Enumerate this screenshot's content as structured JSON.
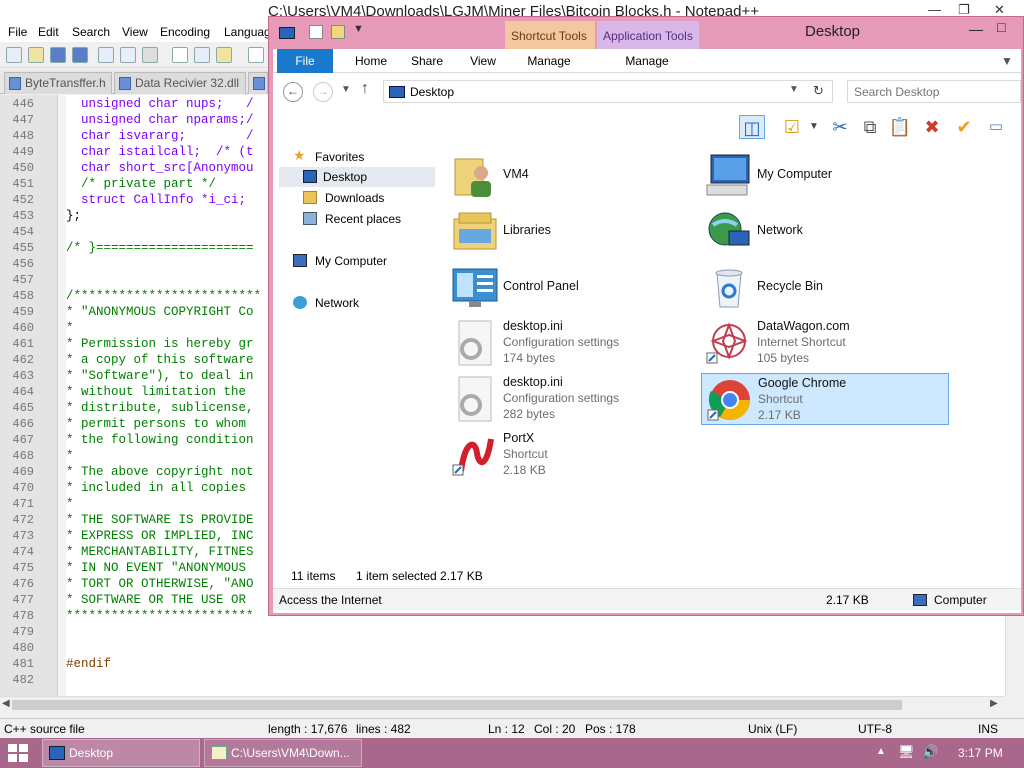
{
  "notepad": {
    "title": "C:\\Users\\VM4\\Downloads\\LGJM\\Miner Files\\Bitcoin Blocks.h - Notepad++",
    "menu": [
      "File",
      "Edit",
      "Search",
      "View",
      "Encoding",
      "Languag"
    ],
    "tabs": [
      "ByteTransffer.h",
      "Data Recivier 32.dll"
    ],
    "lines": [
      {
        "n": "446",
        "code": "  unsigned char nups;   /"
      },
      {
        "n": "447",
        "code": "  unsigned char nparams;/"
      },
      {
        "n": "448",
        "code": "  char isvararg;        /"
      },
      {
        "n": "449",
        "code": "  char istailcall;  /* (t"
      },
      {
        "n": "450",
        "code": "  char short_src[Anonymou"
      },
      {
        "n": "451",
        "code": "  /* private part */"
      },
      {
        "n": "452",
        "code": "  struct CallInfo *i_ci;"
      },
      {
        "n": "453",
        "code": "};"
      },
      {
        "n": "454",
        "code": ""
      },
      {
        "n": "455",
        "code": "/* }====================="
      },
      {
        "n": "456",
        "code": ""
      },
      {
        "n": "457",
        "code": ""
      },
      {
        "n": "458",
        "code": "/*************************"
      },
      {
        "n": "459",
        "code": "* \"ANONYMOUS COPYRIGHT Co"
      },
      {
        "n": "460",
        "code": "*"
      },
      {
        "n": "461",
        "code": "* Permission is hereby gr"
      },
      {
        "n": "462",
        "code": "* a copy of this software"
      },
      {
        "n": "463",
        "code": "* \"Software\"), to deal in"
      },
      {
        "n": "464",
        "code": "* without limitation the"
      },
      {
        "n": "465",
        "code": "* distribute, sublicense,"
      },
      {
        "n": "466",
        "code": "* permit persons to whom"
      },
      {
        "n": "467",
        "code": "* the following condition"
      },
      {
        "n": "468",
        "code": "*"
      },
      {
        "n": "469",
        "code": "* The above copyright not"
      },
      {
        "n": "470",
        "code": "* included in all copies"
      },
      {
        "n": "471",
        "code": "*"
      },
      {
        "n": "472",
        "code": "* THE SOFTWARE IS PROVIDE"
      },
      {
        "n": "473",
        "code": "* EXPRESS OR IMPLIED, INC"
      },
      {
        "n": "474",
        "code": "* MERCHANTABILITY, FITNES"
      },
      {
        "n": "475",
        "code": "* IN NO EVENT \"ANONYMOUS"
      },
      {
        "n": "476",
        "code": "* TORT OR OTHERWISE, \"ANO"
      },
      {
        "n": "477",
        "code": "* SOFTWARE OR THE USE OR"
      },
      {
        "n": "478",
        "code": "*************************"
      },
      {
        "n": "479",
        "code": ""
      },
      {
        "n": "480",
        "code": ""
      },
      {
        "n": "481",
        "code": "#endif"
      },
      {
        "n": "482",
        "code": ""
      }
    ],
    "status": {
      "filetype": "C++ source file",
      "length": "length : 17,676",
      "lines": "lines : 482",
      "ln": "Ln : 12",
      "col": "Col : 20",
      "pos": "Pos : 178",
      "eol": "Unix (LF)",
      "encoding": "UTF-8",
      "mode": "INS"
    }
  },
  "explorer": {
    "title": "Desktop",
    "context_tabs": [
      "Shortcut Tools",
      "Application Tools"
    ],
    "ribbon_tabs": [
      "File",
      "Home",
      "Share",
      "View",
      "Manage",
      "Manage"
    ],
    "address": "Desktop",
    "search_placeholder": "Search Desktop",
    "nav": {
      "favorites": "Favorites",
      "desktop": "Desktop",
      "downloads": "Downloads",
      "recent": "Recent places",
      "computer": "My Computer",
      "network": "Network"
    },
    "files_left": [
      {
        "name": "VM4",
        "icon": "user-folder-icon"
      },
      {
        "name": "Libraries",
        "icon": "libraries-icon"
      },
      {
        "name": "Control Panel",
        "icon": "control-panel-icon"
      },
      {
        "name": "desktop.ini",
        "type": "Configuration settings",
        "size": "174 bytes",
        "icon": "settings-file-icon"
      },
      {
        "name": "desktop.ini",
        "type": "Configuration settings",
        "size": "282 bytes",
        "icon": "settings-file-icon"
      },
      {
        "name": "PortX",
        "type": "Shortcut",
        "size": "2.18 KB",
        "icon": "portx-icon"
      }
    ],
    "files_right": [
      {
        "name": "My Computer",
        "icon": "computer-icon"
      },
      {
        "name": "Network",
        "icon": "network-icon"
      },
      {
        "name": "Recycle Bin",
        "icon": "recycle-bin-icon"
      },
      {
        "name": "DataWagon.com",
        "type": "Internet Shortcut",
        "size": "105 bytes",
        "icon": "web-shortcut-icon"
      },
      {
        "name": "Google Chrome",
        "type": "Shortcut",
        "size": "2.17 KB",
        "icon": "chrome-icon",
        "selected": true
      }
    ],
    "status": {
      "count": "11 items",
      "selected": "1 item selected  2.17 KB"
    },
    "footer": {
      "info": "Access the Internet",
      "size": "2.17 KB",
      "location": "Computer"
    }
  },
  "taskbar": {
    "items": [
      "Desktop",
      "C:\\Users\\VM4\\Down..."
    ],
    "clock": "3:17 PM"
  },
  "colors": {
    "explorer_border": "#e79ab8",
    "taskbar": "#a9678c",
    "file_tab": "#1979ca",
    "selection": "#cde8ff"
  }
}
